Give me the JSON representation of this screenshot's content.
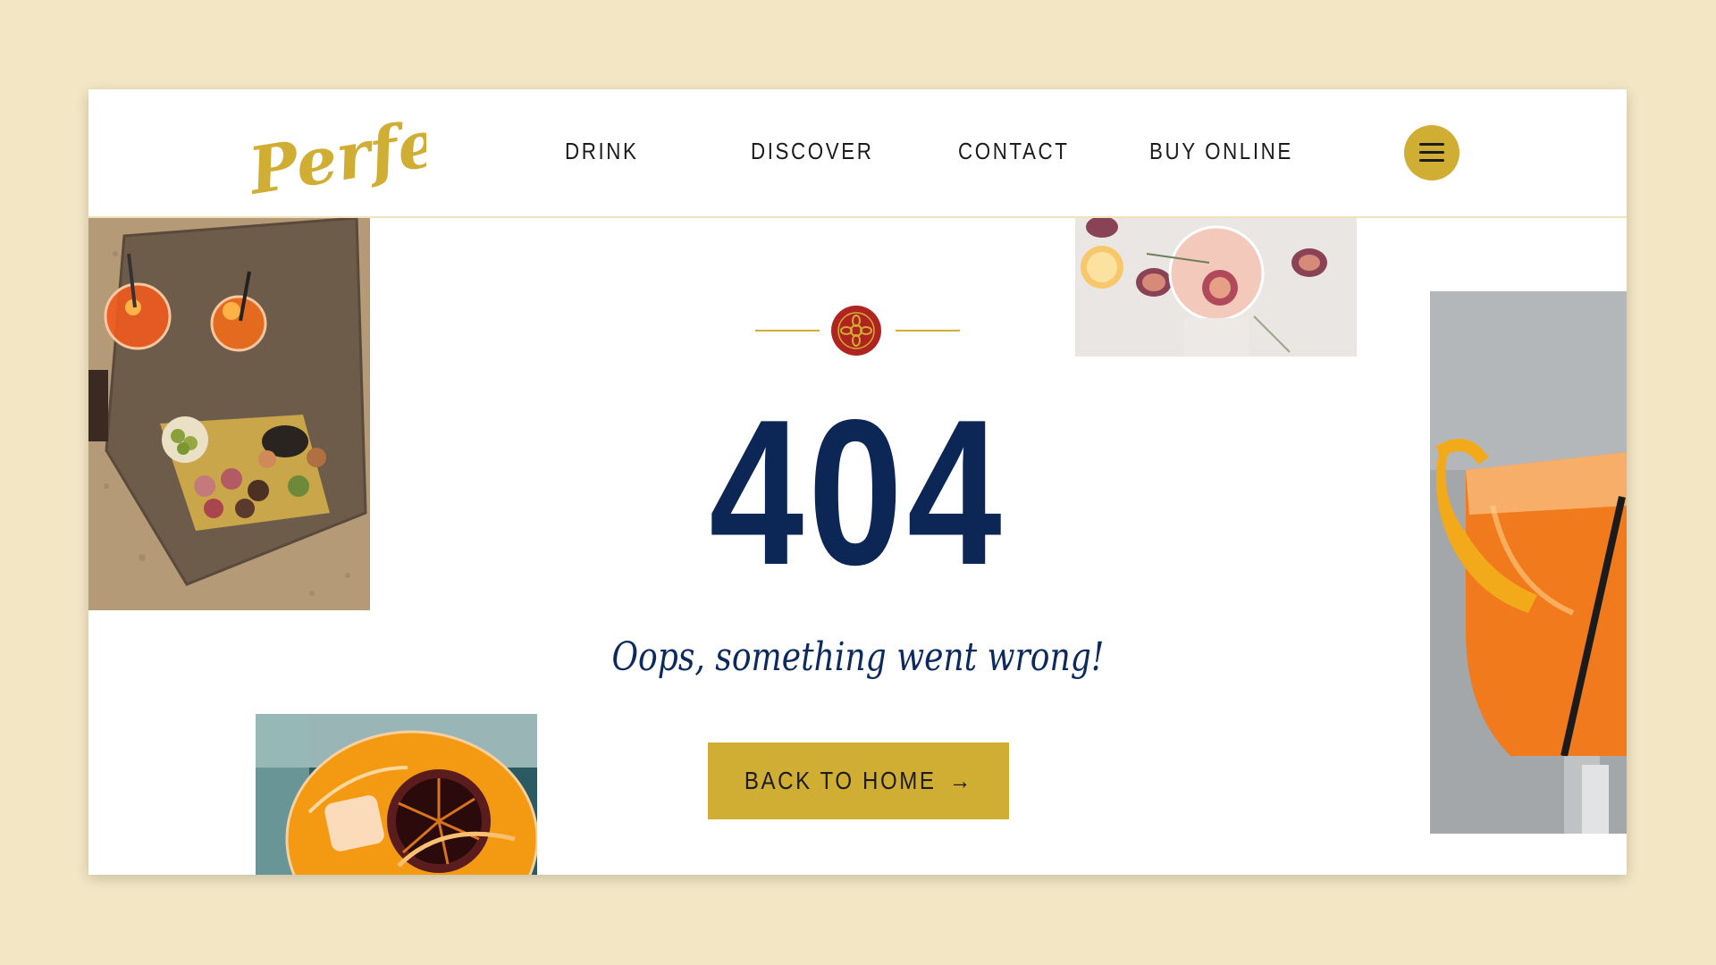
{
  "brand": {
    "logo_text": "Perfetto"
  },
  "nav": {
    "items": [
      {
        "label": "DRINK"
      },
      {
        "label": "DISCOVER"
      },
      {
        "label": "CONTACT"
      },
      {
        "label": "BUY ONLINE"
      }
    ]
  },
  "error": {
    "code": "404",
    "message": "Oops, something went wrong!"
  },
  "cta": {
    "label": "BACK TO HOME",
    "arrow": "→"
  },
  "colors": {
    "accent": "#d0ad33",
    "navy": "#0c2656",
    "badge_red": "#b0241f",
    "background": "#f2e6c4"
  },
  "icons": {
    "menu": "hamburger-menu-icon",
    "badge": "ornament-badge-icon",
    "arrow": "arrow-right-icon"
  }
}
